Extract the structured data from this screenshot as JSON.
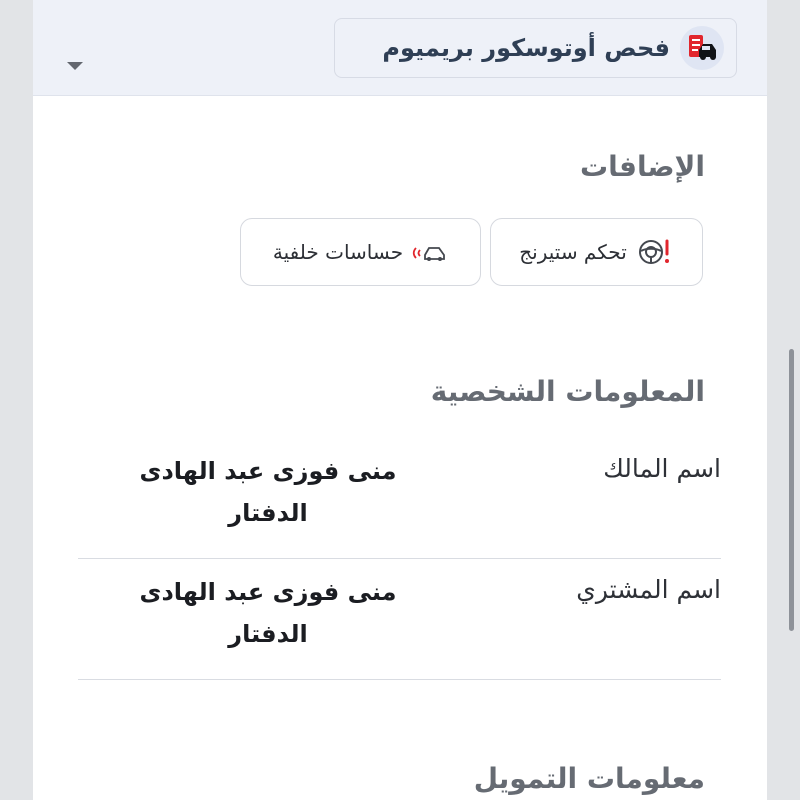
{
  "header": {
    "service_title": "فحص أوتوسكور بريميوم",
    "service_icon": "car-report-icon",
    "dropdown_icon": "caret-down-icon"
  },
  "addons": {
    "title": "الإضافات",
    "items": [
      {
        "label": "تحكم ستيرنج",
        "icon": "steering-warning-icon"
      },
      {
        "label": "حساسات خلفية",
        "icon": "rear-sensor-icon"
      }
    ]
  },
  "personal_info": {
    "title": "المعلومات الشخصية",
    "rows": [
      {
        "label": "اسم المالك",
        "value": "منى فوزى عبد الهادى الدفتار"
      },
      {
        "label": "اسم المشتري",
        "value": "منى فوزى عبد الهادى الدفتار"
      }
    ]
  },
  "finance_info": {
    "title": "معلومات التمويل"
  },
  "colors": {
    "header_bg": "#eef1f8",
    "accent_red": "#e1262d",
    "title_text": "#2f3f55",
    "muted_heading": "#666b73"
  }
}
